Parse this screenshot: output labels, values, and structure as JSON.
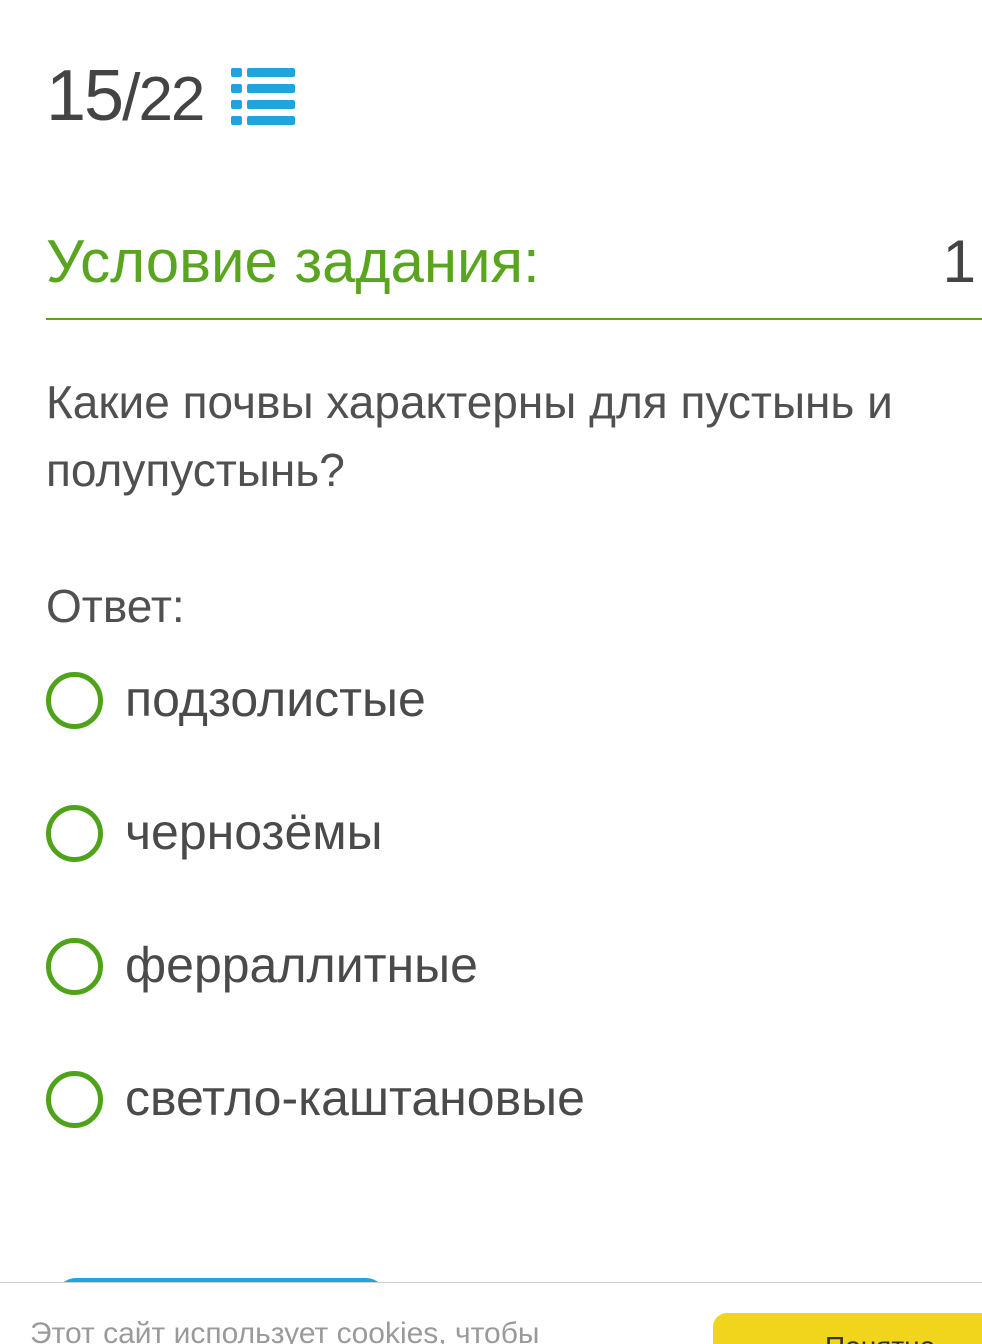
{
  "header": {
    "current": "15",
    "separator": "/",
    "total": "22"
  },
  "section": {
    "title": "Условие задания:",
    "points": "1"
  },
  "question": {
    "text": "Какие почвы характерны для пустынь и полупустынь?"
  },
  "answer": {
    "label": "Ответ:",
    "options": [
      {
        "label": "подзолистые"
      },
      {
        "label": "чернозёмы"
      },
      {
        "label": "ферраллитные"
      },
      {
        "label": "светло-каштановые"
      }
    ]
  },
  "cookie_bar": {
    "text": "Этот сайт использует cookies, чтобы",
    "button_label": "Понятно"
  },
  "colors": {
    "accent_green": "#5aa520",
    "icon_blue": "#1fa4dd",
    "cookie_button": "#f0d51c"
  }
}
